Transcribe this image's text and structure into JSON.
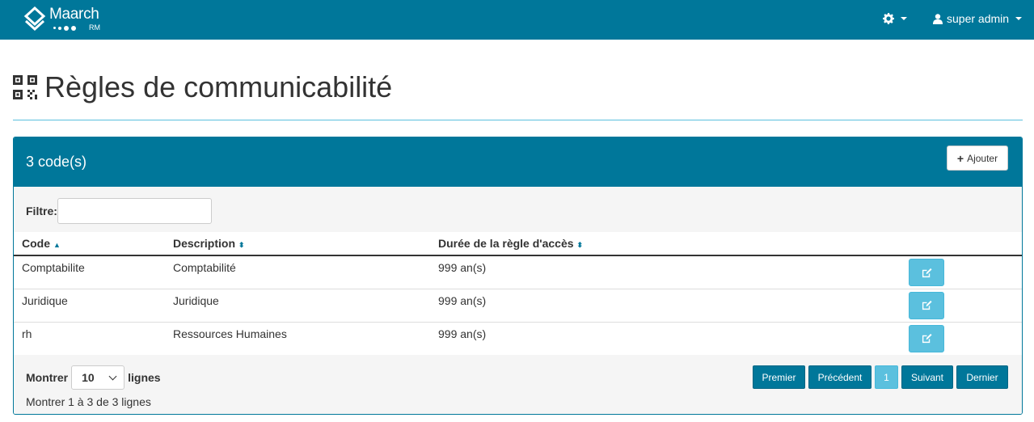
{
  "navbar": {
    "brand_name": "Maarch",
    "brand_sub": "RM",
    "user_label": "super admin",
    "color": "#00779a"
  },
  "page": {
    "title": "Règles de communicabilité",
    "title_icon": "qrcode-icon"
  },
  "panel": {
    "title": "3 code(s)",
    "add_button_label": "Ajouter"
  },
  "filter": {
    "label": "Filtre:",
    "value": ""
  },
  "table": {
    "columns": [
      "Code",
      "Description",
      "Durée de la règle d'accès"
    ],
    "rows": [
      {
        "code": "Comptabilite",
        "description": "Comptabilité",
        "duration": "999 an(s)"
      },
      {
        "code": "Juridique",
        "description": "Juridique",
        "duration": "999 an(s)"
      },
      {
        "code": "rh",
        "description": "Ressources Humaines",
        "duration": "999 an(s)"
      }
    ]
  },
  "footer": {
    "show_label": "Montrer",
    "page_size": "10",
    "lines_label": "lignes",
    "info": "Montrer 1 à 3 de 3 lignes"
  },
  "pagination": {
    "first": "Premier",
    "previous": "Précédent",
    "current": "1",
    "next": "Suivant",
    "last": "Dernier"
  }
}
